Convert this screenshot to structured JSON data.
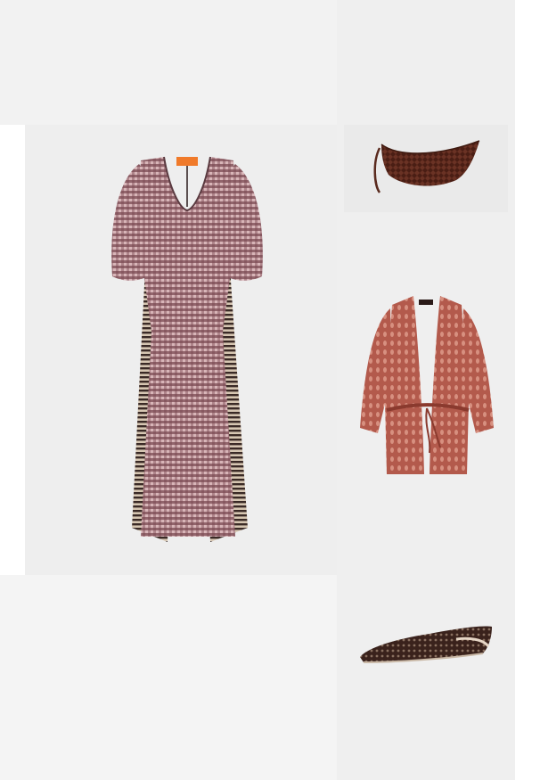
{
  "collage": {
    "items": [
      {
        "id": "dress",
        "icon": "gingham-midi-dress-image"
      },
      {
        "id": "bag",
        "icon": "woven-leather-shoulder-bag-image"
      },
      {
        "id": "cardigan",
        "icon": "open-knit-belted-cardigan-image"
      },
      {
        "id": "shoe",
        "icon": "woven-leather-flat-shoe-image"
      }
    ],
    "colors": {
      "dress_pink": "#c79aa0",
      "dress_dark": "#4a2a30",
      "bag_brown": "#5a2a1e",
      "cardigan_rust": "#b85a4c",
      "shoe_brown": "#3a221c",
      "label_orange": "#f07a2a"
    }
  }
}
